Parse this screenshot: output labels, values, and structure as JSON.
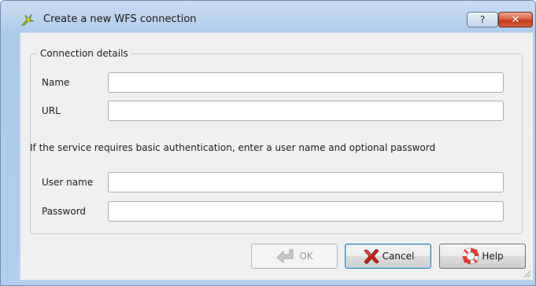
{
  "window": {
    "title": "Create a new WFS connection",
    "help_glyph": "?",
    "close_glyph": "✕"
  },
  "group": {
    "title": "Connection details"
  },
  "fields": {
    "name": {
      "label": "Name",
      "value": ""
    },
    "url": {
      "label": "URL",
      "value": ""
    },
    "username": {
      "label": "User name",
      "value": ""
    },
    "password": {
      "label": "Password",
      "value": ""
    }
  },
  "info_text": "If the service requires basic authentication, enter a user name and optional password",
  "buttons": {
    "ok": {
      "label": "OK",
      "icon": "ok-arrow-icon",
      "enabled": false
    },
    "cancel": {
      "label": "Cancel",
      "icon": "red-x-icon"
    },
    "help": {
      "label": "Help",
      "icon": "lifebuoy-icon"
    }
  },
  "colors": {
    "title_bar": "#b9d1ec",
    "close_button": "#c13b1f",
    "dialog_background": "#f0f0f0",
    "default_button_border": "#3c7fb1"
  }
}
